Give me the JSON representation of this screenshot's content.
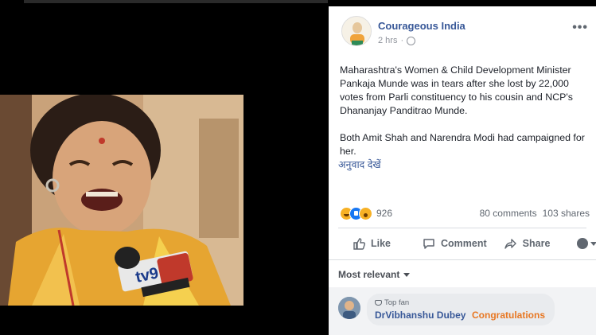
{
  "post": {
    "page_name": "Courageous India",
    "time": "2 hrs",
    "paragraph1": "Maharashtra's Women & Child Development Minister Pankaja Munde was in tears after she lost by 22,000 votes from Parli constituency to his cousin and NCP's Dhananjay Panditrao Munde.",
    "paragraph2": "Both Amit Shah and Narendra Modi had campaigned for her.",
    "translate_link": "अनुवाद देखें",
    "photo_overlay_text": "tv9"
  },
  "stats": {
    "reaction_count": "926",
    "comments": "80 comments",
    "shares": "103 shares"
  },
  "actions": {
    "like": "Like",
    "comment": "Comment",
    "share": "Share"
  },
  "comments_section": {
    "sort_label": "Most relevant",
    "first_comment": {
      "badge": "Top fan",
      "author": "DrVibhanshu Dubey",
      "text": "Congratulations"
    }
  },
  "icons": {
    "reactions": [
      "haha-icon",
      "like-icon",
      "wow-icon"
    ],
    "more": "more-options-icon",
    "privacy": "globe-icon"
  },
  "colors": {
    "link": "#385898",
    "comment_highlight": "#e87722",
    "muted": "#90949c"
  }
}
